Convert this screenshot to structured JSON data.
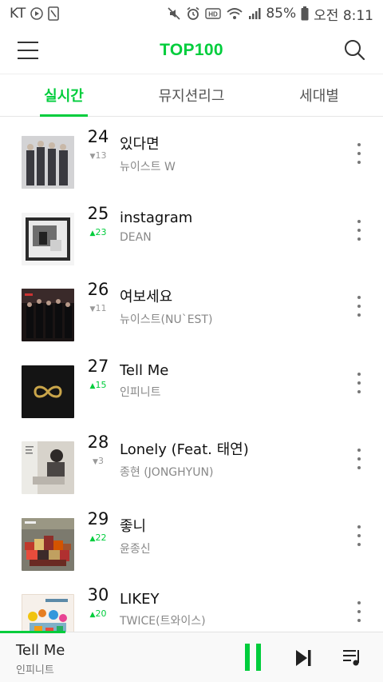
{
  "status_bar": {
    "carrier": "KT",
    "battery": "85%",
    "time": "오전 8:11"
  },
  "header": {
    "title": "TOP100"
  },
  "tabs": [
    {
      "label": "실시간",
      "active": true
    },
    {
      "label": "뮤지션리그",
      "active": false
    },
    {
      "label": "세대별",
      "active": false
    }
  ],
  "chart": [
    {
      "rank": "24",
      "change": "13",
      "direction": "down",
      "title": "있다면",
      "artist": "뉴이스트 W"
    },
    {
      "rank": "25",
      "change": "23",
      "direction": "up",
      "title": "instagram",
      "artist": "DEAN"
    },
    {
      "rank": "26",
      "change": "11",
      "direction": "down",
      "title": "여보세요",
      "artist": "뉴이스트(NU`EST)"
    },
    {
      "rank": "27",
      "change": "15",
      "direction": "up",
      "title": "Tell Me",
      "artist": "인피니트"
    },
    {
      "rank": "28",
      "change": "3",
      "direction": "down",
      "title": "Lonely (Feat. 태연)",
      "artist": "종현 (JONGHYUN)"
    },
    {
      "rank": "29",
      "change": "22",
      "direction": "up",
      "title": "좋니",
      "artist": "윤종신"
    },
    {
      "rank": "30",
      "change": "20",
      "direction": "up",
      "title": "LIKEY",
      "artist": "TWICE(트와이스)"
    }
  ],
  "player": {
    "title": "Tell Me",
    "artist": "인피니트",
    "progress": 0.17
  },
  "colors": {
    "accent": "#00cd3c",
    "text": "#111111",
    "muted": "#888888"
  }
}
